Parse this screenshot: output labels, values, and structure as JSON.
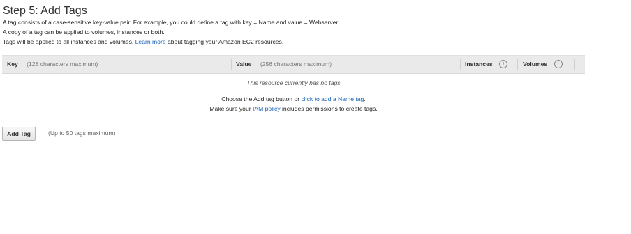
{
  "page": {
    "title": "Step 5: Add Tags",
    "description_line1": "A tag consists of a case-sensitive key-value pair. For example, you could define a tag with key = Name and value = Webserver.",
    "description_line2": "A copy of a tag can be applied to volumes, instances or both.",
    "description_line3_before": "Tags will be applied to all instances and volumes.",
    "learn_more_link": "Learn more",
    "description_line3_after": "about tagging your Amazon EC2 resources."
  },
  "table": {
    "columns": {
      "key_label": "Key",
      "key_hint": "(128 characters maximum)",
      "value_label": "Value",
      "value_hint": "(256 characters maximum)",
      "instances_label": "Instances",
      "volumes_label": "Volumes",
      "info_glyph": "i"
    },
    "empty": {
      "note": "This resource currently has no tags",
      "line1_before": "Choose the Add tag button or",
      "line1_link": "click to add a Name tag",
      "line1_after": ".",
      "line2_before": "Make sure your",
      "line2_link": "IAM policy",
      "line2_after": "includes permissions to create tags."
    }
  },
  "actions": {
    "add_tag_label": "Add Tag",
    "add_tag_limit": "(Up to 50 tags maximum)"
  },
  "colors": {
    "link": "#1a63b5",
    "header_bg": "#eaeaea"
  }
}
